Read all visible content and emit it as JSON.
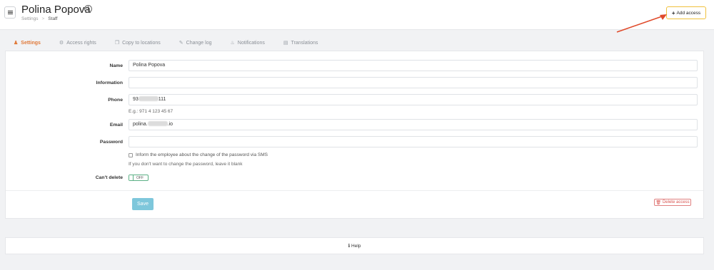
{
  "header": {
    "title": "Polina Popova",
    "breadcrumb": [
      "Settings",
      "Staff"
    ],
    "add_access_label": "Add access"
  },
  "tabs": [
    {
      "label": "Settings",
      "icon": "person-icon",
      "active": true
    },
    {
      "label": "Access rights",
      "icon": "gears-icon",
      "active": false
    },
    {
      "label": "Copy to locations",
      "icon": "copy-icon",
      "active": false
    },
    {
      "label": "Change log",
      "icon": "edit-icon",
      "active": false
    },
    {
      "label": "Notifications",
      "icon": "bell-icon",
      "active": false
    },
    {
      "label": "Translations",
      "icon": "translate-icon",
      "active": false
    }
  ],
  "form": {
    "name_label": "Name",
    "name_value": "Polina Popova",
    "information_label": "Information",
    "information_value": "",
    "phone_label": "Phone",
    "phone_prefix": "93",
    "phone_suffix": "111",
    "phone_hint": "E.g.: 971 4 123 45 67",
    "email_label": "Email",
    "email_prefix": "polina.",
    "email_suffix": ".io",
    "password_label": "Password",
    "password_value": "",
    "sms_checkbox_label": "Inform the employee about the change of the password via SMS",
    "password_hint": "If you don't want to change the password, leave it blank",
    "cant_delete_label": "Can't delete",
    "cant_delete_toggle": "OFF",
    "save_label": "Save",
    "delete_label": "Delete access"
  },
  "footer": {
    "help_label": "Help"
  },
  "colors": {
    "accent_tab": "#e07a3a",
    "add_access_border": "#f0c13c",
    "save_button": "#7ec7db",
    "delete_red": "#d9534f",
    "toggle_green": "#5cb085",
    "annotation_arrow": "#e04a2a"
  }
}
